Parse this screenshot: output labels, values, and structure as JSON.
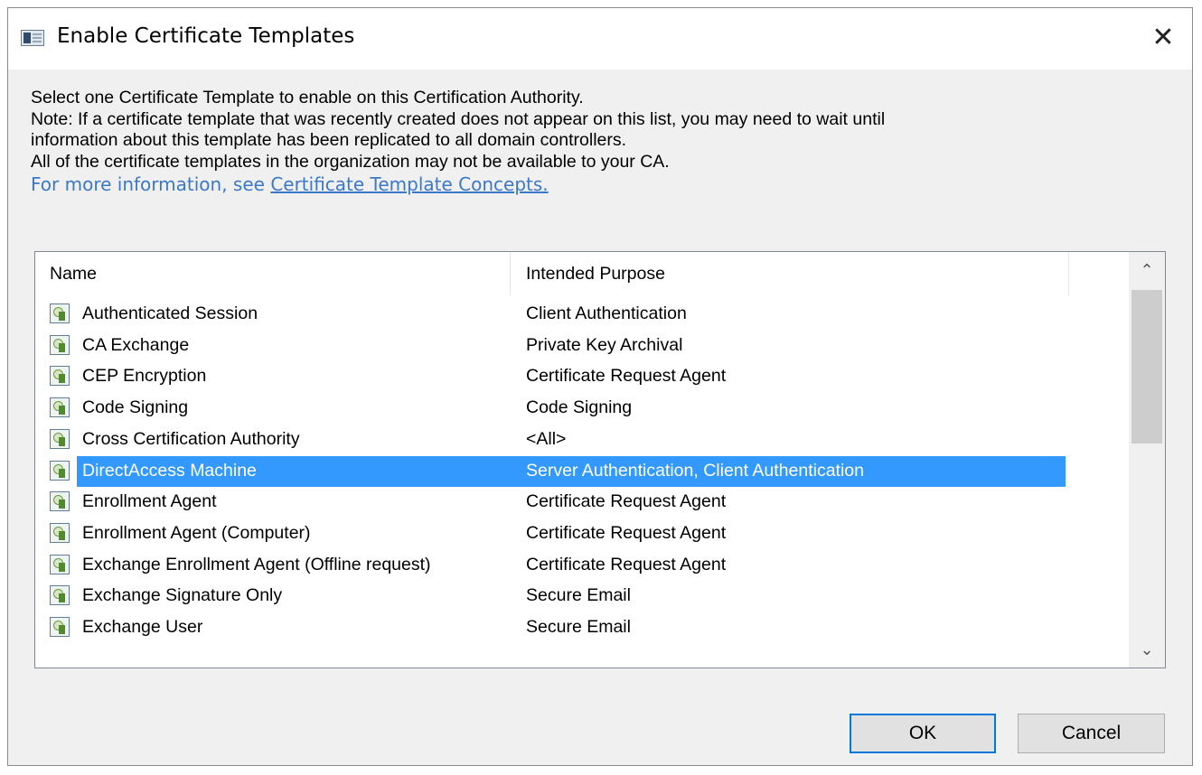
{
  "window": {
    "title": "Enable Certificate Templates",
    "close_glyph": "✕"
  },
  "description": {
    "line1": "Select one Certificate Template to enable on this Certification Authority.",
    "line2": "Note: If a certificate template that was recently created does not appear on this list, you may need to wait until",
    "line3": "information about this template has been replicated to all domain controllers.",
    "line4": "All of the certificate templates in the organization may not be available to your CA.",
    "more_info_prefix": "For more information, see ",
    "more_info_link": "Certificate Template Concepts."
  },
  "list": {
    "columns": {
      "name": "Name",
      "purpose": "Intended Purpose"
    },
    "rows": [
      {
        "name": "Authenticated Session",
        "purpose": "Client Authentication",
        "selected": false
      },
      {
        "name": "CA Exchange",
        "purpose": "Private Key Archival",
        "selected": false
      },
      {
        "name": "CEP Encryption",
        "purpose": "Certificate Request Agent",
        "selected": false
      },
      {
        "name": "Code Signing",
        "purpose": "Code Signing",
        "selected": false
      },
      {
        "name": "Cross Certification Authority",
        "purpose": "<All>",
        "selected": false
      },
      {
        "name": "DirectAccess Machine",
        "purpose": "Server Authentication, Client Authentication",
        "selected": true
      },
      {
        "name": "Enrollment Agent",
        "purpose": "Certificate Request Agent",
        "selected": false
      },
      {
        "name": "Enrollment Agent (Computer)",
        "purpose": "Certificate Request Agent",
        "selected": false
      },
      {
        "name": "Exchange Enrollment Agent (Offline request)",
        "purpose": "Certificate Request Agent",
        "selected": false
      },
      {
        "name": "Exchange Signature Only",
        "purpose": "Secure Email",
        "selected": false
      },
      {
        "name": "Exchange User",
        "purpose": "Secure Email",
        "selected": false
      }
    ],
    "scroll_up_glyph": "⌃",
    "scroll_down_glyph": "⌄"
  },
  "buttons": {
    "ok": "OK",
    "cancel": "Cancel"
  },
  "colors": {
    "selection": "#3399ff",
    "link": "#3c78c8",
    "default_button_border": "#0078d7"
  }
}
